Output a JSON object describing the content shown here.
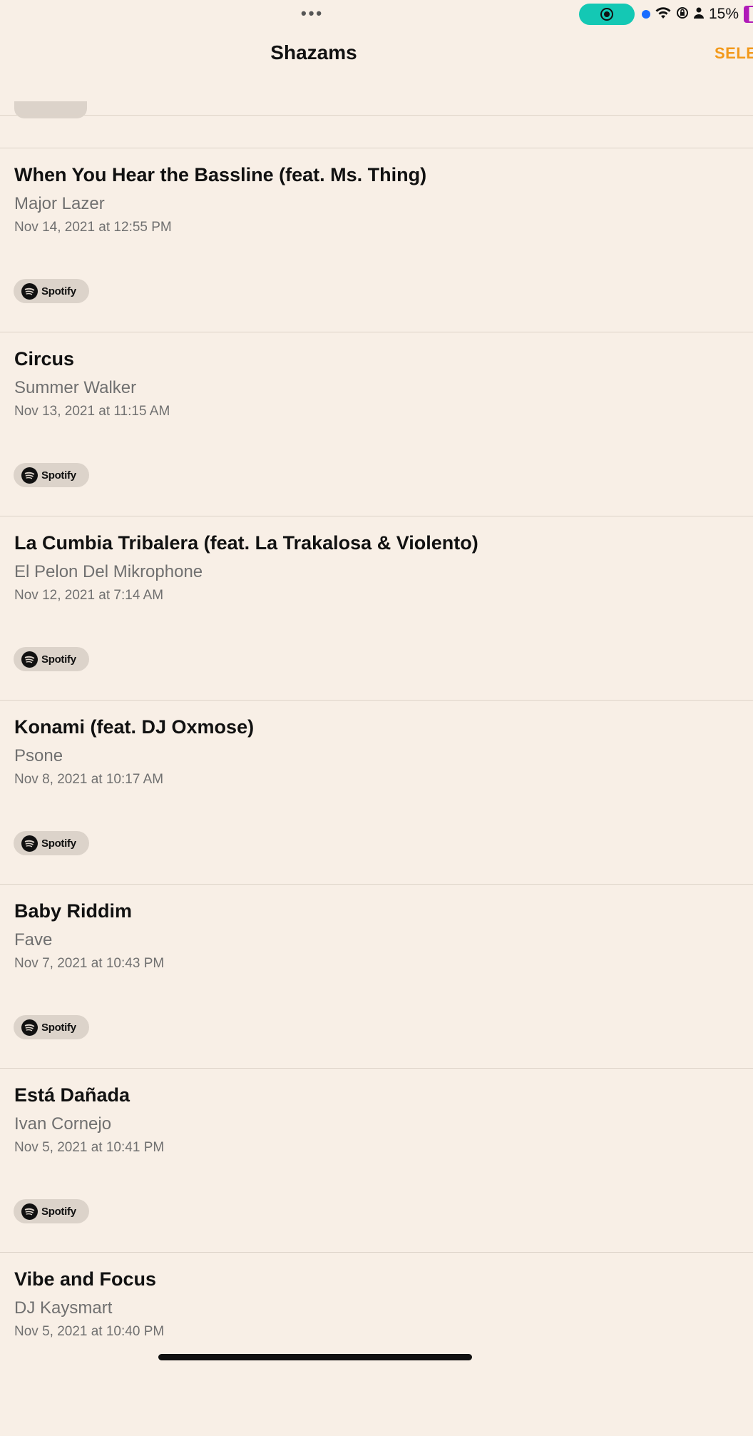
{
  "status_bar": {
    "battery_percent": "15%",
    "icons": [
      "more-dots-icon",
      "screen-record-icon",
      "location-dot-icon",
      "wifi-icon",
      "orientation-lock-icon",
      "person-icon",
      "battery-icon"
    ]
  },
  "nav": {
    "title": "Shazams",
    "select_label": "SELE"
  },
  "spotify_label": "Spotify",
  "items": [
    {
      "title": "When You Hear the Bassline (feat. Ms. Thing)",
      "artist": "Major Lazer",
      "date": "Nov 14, 2021 at 12:55 PM"
    },
    {
      "title": "Circus",
      "artist": "Summer Walker",
      "date": "Nov 13, 2021 at 11:15 AM"
    },
    {
      "title": "La Cumbia Tribalera (feat. La Trakalosa & Violento)",
      "artist": "El Pelon Del Mikrophone",
      "date": "Nov 12, 2021 at 7:14 AM"
    },
    {
      "title": "Konami (feat. DJ Oxmose)",
      "artist": "Psone",
      "date": "Nov 8, 2021 at 10:17 AM"
    },
    {
      "title": "Baby Riddim",
      "artist": "Fave",
      "date": "Nov 7, 2021 at 10:43 PM"
    },
    {
      "title": "Está Dañada",
      "artist": "Ivan Cornejo",
      "date": "Nov 5, 2021 at 10:41 PM"
    },
    {
      "title": "Vibe and Focus",
      "artist": "DJ Kaysmart",
      "date": "Nov 5, 2021 at 10:40 PM"
    }
  ],
  "colors": {
    "background": "#f8efe6",
    "accent": "#f2991b",
    "record_pill": "#14c8b4",
    "badge_bg": "#dcd3ca"
  }
}
